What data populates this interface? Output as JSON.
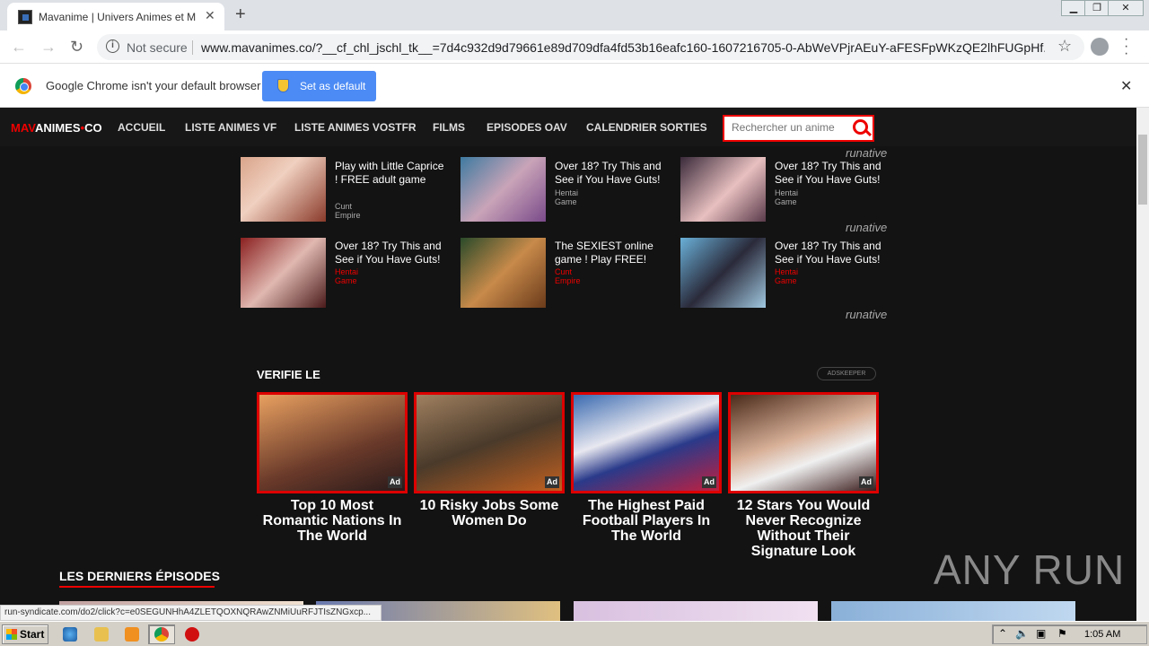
{
  "browser": {
    "tab_title": "Mavanime | Univers Animes et Mang",
    "not_secure": "Not secure",
    "url": "www.mavanimes.co/?__cf_chl_jschl_tk__=7d4c932d9d79661e89d709dfa4fd53b16eafc160-1607216705-0-AbWeVPjrAEuY-aFESFpWKzQE2lhFUGpHf...",
    "infobar_text": "Google Chrome isn't your default browser",
    "set_default_label": "Set as default",
    "status_url": "run-syndicate.com/do2/click?c=e0SEGUNHhA4ZLETQOXNQRAwZNMiUuRFJTIsZNGxcp..."
  },
  "site": {
    "logo_red": "MAV",
    "logo_white": "ANIMES",
    "logo_dot": "•",
    "logo_tld": "CO",
    "nav": [
      "ACCUEIL",
      "LISTE ANIMES VF",
      "LISTE ANIMES VOSTFR",
      "FILMS",
      "EPISODES OAV",
      "CALENDRIER SORTIES"
    ],
    "search_placeholder": "Rechercher un anime",
    "runative": "runative",
    "ads": [
      {
        "title": "Play with Little Caprice ! FREE adult game",
        "source": "Cunt Empire"
      },
      {
        "title": "Over 18? Try This and See if You Have Guts!",
        "source": "Hentai Game"
      },
      {
        "title": "Over 18? Try This and See if You Have Guts!",
        "source": "Hentai Game"
      },
      {
        "title": "Over 18? Try This and See if You Have Guts!",
        "source": "Hentai Game"
      },
      {
        "title": "The SEXIEST online game ! Play FREE!",
        "source": "Cunt Empire"
      },
      {
        "title": "Over 18? Try This and See if You Have Guts!",
        "source": "Hentai Game"
      }
    ],
    "verifie_label": "VERIFIE LE",
    "adskeeper": "ADSKEEPER",
    "ad_badge": "Ad",
    "cards": [
      {
        "title": "Top 10 Most Romantic Nations In The World"
      },
      {
        "title": "10 Risky Jobs Some Women Do"
      },
      {
        "title": "The Highest Paid Football Players In The World"
      },
      {
        "title": "12 Stars You Would Never Recognize Without Their Signature Look"
      }
    ],
    "latest_heading": "LES DERNIERS ÉPISODES",
    "watermark": "ANY RUN"
  },
  "taskbar": {
    "start_label": "Start",
    "clock": "1:05 AM"
  },
  "colors": {
    "accent": "#dd0000",
    "infobar_button": "#4c8bf5"
  }
}
